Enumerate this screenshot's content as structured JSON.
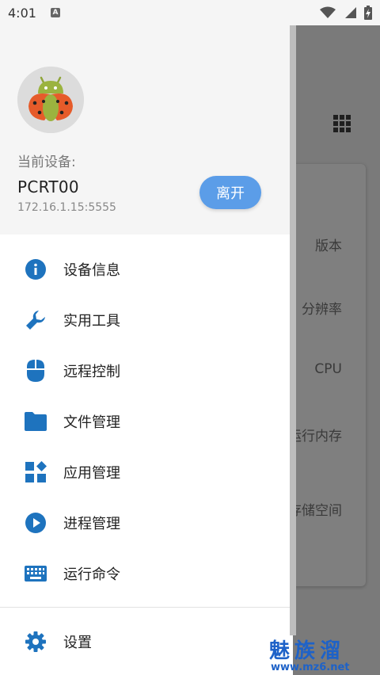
{
  "status_bar": {
    "time": "4:01",
    "notification_icon": "A",
    "icons": [
      "wifi-icon",
      "signal-icon",
      "battery-charging-icon"
    ]
  },
  "drawer": {
    "header": {
      "current_device_label": "当前设备:",
      "device_name": "PCRT00",
      "device_ip": "172.16.1.15:5555",
      "leave_button": "离开",
      "avatar_icon": "ladybug-android-icon"
    },
    "items": [
      {
        "label": "设备信息",
        "icon": "info-icon"
      },
      {
        "label": "实用工具",
        "icon": "wrench-icon"
      },
      {
        "label": "远程控制",
        "icon": "mouse-icon"
      },
      {
        "label": "文件管理",
        "icon": "folder-icon"
      },
      {
        "label": "应用管理",
        "icon": "apps-icon"
      },
      {
        "label": "进程管理",
        "icon": "play-circle-icon"
      },
      {
        "label": "运行命令",
        "icon": "keyboard-icon"
      }
    ],
    "settings": {
      "label": "设置",
      "icon": "gear-icon"
    }
  },
  "background": {
    "grid_icon": "apps-grid-icon",
    "labels": [
      "版本",
      "分辨率",
      "CPU",
      "运行内存",
      "存储空间"
    ]
  },
  "watermark": {
    "title": "魅族溜",
    "url": "www.mz6.net"
  },
  "colors": {
    "accent": "#1e73be",
    "button": "#5b9de8",
    "header_bg": "#f5f5f5",
    "watermark": "#1e62c8"
  }
}
